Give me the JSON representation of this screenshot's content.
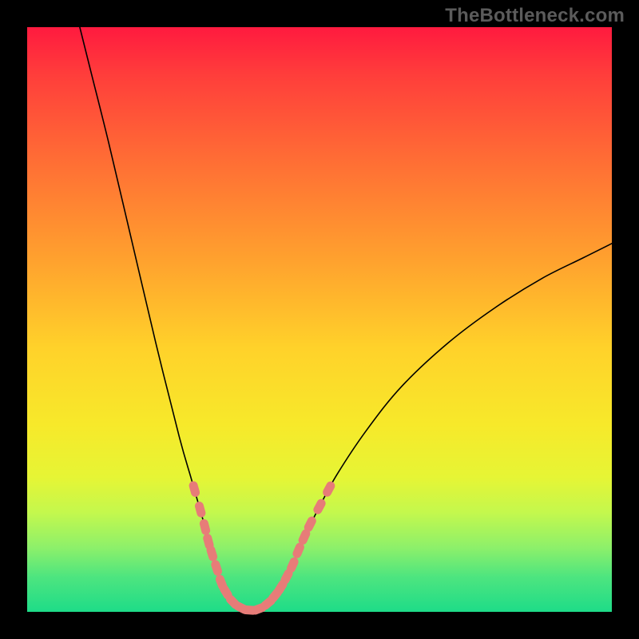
{
  "attribution": "TheBottleneck.com",
  "chart_data": {
    "type": "line",
    "title": "",
    "xlabel": "",
    "ylabel": "",
    "xlim": [
      0,
      100
    ],
    "ylim": [
      0,
      100
    ],
    "legend": false,
    "grid": false,
    "background_gradient": {
      "orientation": "vertical",
      "stops": [
        {
          "pos": 0,
          "color": "#ff1a3f"
        },
        {
          "pos": 50,
          "color": "#ffd22a"
        },
        {
          "pos": 80,
          "color": "#e6f535"
        },
        {
          "pos": 100,
          "color": "#1edc88"
        }
      ]
    },
    "series": [
      {
        "name": "curve",
        "color": "#000000",
        "linewidth": 1.4,
        "points": [
          {
            "x": 9.0,
            "y": 100.0
          },
          {
            "x": 11.0,
            "y": 92.0
          },
          {
            "x": 14.0,
            "y": 80.0
          },
          {
            "x": 18.0,
            "y": 63.0
          },
          {
            "x": 22.0,
            "y": 46.0
          },
          {
            "x": 26.0,
            "y": 30.0
          },
          {
            "x": 28.0,
            "y": 23.0
          },
          {
            "x": 29.0,
            "y": 19.5
          },
          {
            "x": 30.0,
            "y": 16.0
          },
          {
            "x": 31.0,
            "y": 12.5
          },
          {
            "x": 32.0,
            "y": 9.0
          },
          {
            "x": 33.0,
            "y": 6.0
          },
          {
            "x": 34.0,
            "y": 3.8
          },
          {
            "x": 35.0,
            "y": 2.2
          },
          {
            "x": 36.0,
            "y": 1.2
          },
          {
            "x": 37.0,
            "y": 0.6
          },
          {
            "x": 38.0,
            "y": 0.3
          },
          {
            "x": 39.0,
            "y": 0.4
          },
          {
            "x": 40.0,
            "y": 0.7
          },
          {
            "x": 41.0,
            "y": 1.3
          },
          {
            "x": 42.0,
            "y": 2.2
          },
          {
            "x": 43.0,
            "y": 3.4
          },
          {
            "x": 44.0,
            "y": 5.2
          },
          {
            "x": 46.0,
            "y": 9.5
          },
          {
            "x": 48.0,
            "y": 14.0
          },
          {
            "x": 50.0,
            "y": 18.0
          },
          {
            "x": 53.0,
            "y": 23.5
          },
          {
            "x": 58.0,
            "y": 31.0
          },
          {
            "x": 64.0,
            "y": 38.5
          },
          {
            "x": 72.0,
            "y": 46.0
          },
          {
            "x": 80.0,
            "y": 52.0
          },
          {
            "x": 88.0,
            "y": 57.0
          },
          {
            "x": 95.0,
            "y": 60.5
          },
          {
            "x": 100.0,
            "y": 63.0
          }
        ]
      },
      {
        "name": "markers",
        "type": "scatter",
        "color": "#e77c78",
        "marker_shape": "rounded-bar",
        "points": [
          {
            "x": 28.6,
            "y": 21.0
          },
          {
            "x": 29.6,
            "y": 17.5
          },
          {
            "x": 30.4,
            "y": 14.5
          },
          {
            "x": 31.0,
            "y": 12.0
          },
          {
            "x": 31.6,
            "y": 10.0
          },
          {
            "x": 32.4,
            "y": 7.5
          },
          {
            "x": 33.2,
            "y": 5.0
          },
          {
            "x": 34.0,
            "y": 3.4
          },
          {
            "x": 35.2,
            "y": 1.7
          },
          {
            "x": 36.6,
            "y": 0.7
          },
          {
            "x": 38.0,
            "y": 0.3
          },
          {
            "x": 39.6,
            "y": 0.5
          },
          {
            "x": 41.2,
            "y": 1.5
          },
          {
            "x": 42.4,
            "y": 2.8
          },
          {
            "x": 43.4,
            "y": 4.2
          },
          {
            "x": 44.4,
            "y": 6.0
          },
          {
            "x": 45.4,
            "y": 8.0
          },
          {
            "x": 46.4,
            "y": 10.5
          },
          {
            "x": 47.4,
            "y": 12.8
          },
          {
            "x": 48.4,
            "y": 15.0
          },
          {
            "x": 50.0,
            "y": 18.0
          },
          {
            "x": 51.6,
            "y": 21.0
          }
        ]
      }
    ]
  }
}
